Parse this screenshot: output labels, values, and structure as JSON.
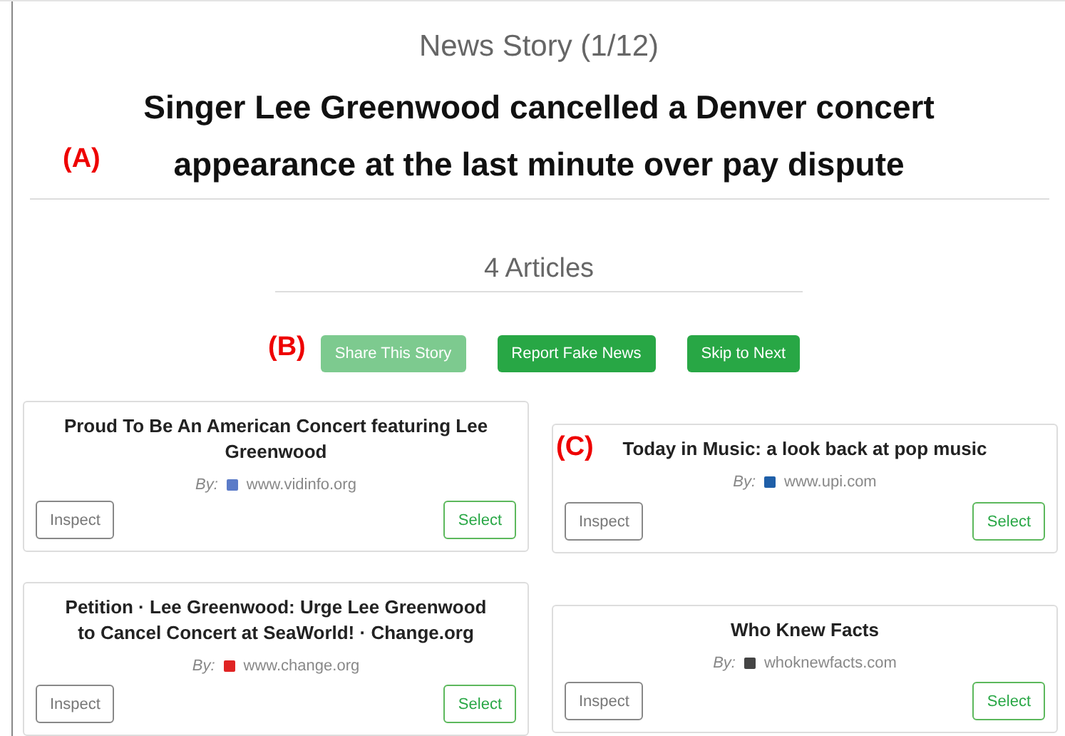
{
  "header": {
    "subtitle": "News Story (1/12)",
    "headline": "Singer Lee Greenwood cancelled a Denver concert appearance at the last minute over pay dispute"
  },
  "articles_count": "4 Articles",
  "actions": [
    {
      "label": "Share This Story",
      "disabled": true
    },
    {
      "label": "Report Fake News",
      "disabled": false
    },
    {
      "label": "Skip to Next",
      "disabled": false
    }
  ],
  "articles": [
    {
      "title": "Proud To Be An American Concert featuring Lee Greenwood",
      "by": "By:",
      "source": "www.vidinfo.org",
      "color": "#5b7bc8",
      "inspect": "Inspect",
      "select": "Select"
    },
    {
      "title": "Today in Music: a look back at pop music",
      "by": "By:",
      "source": "www.upi.com",
      "color": "#1f5fa8",
      "inspect": "Inspect",
      "select": "Select"
    },
    {
      "title": "Petition · Lee Greenwood: Urge Lee Greenwood to Cancel Concert at SeaWorld! · Change.org",
      "by": "By:",
      "source": "www.change.org",
      "color": "#e02424",
      "inspect": "Inspect",
      "select": "Select"
    },
    {
      "title": "Who Knew Facts",
      "by": "By:",
      "source": "whoknewfacts.com",
      "color": "#444444",
      "inspect": "Inspect",
      "select": "Select"
    }
  ],
  "annotations": [
    "(A)",
    "(B)",
    "(C)"
  ]
}
